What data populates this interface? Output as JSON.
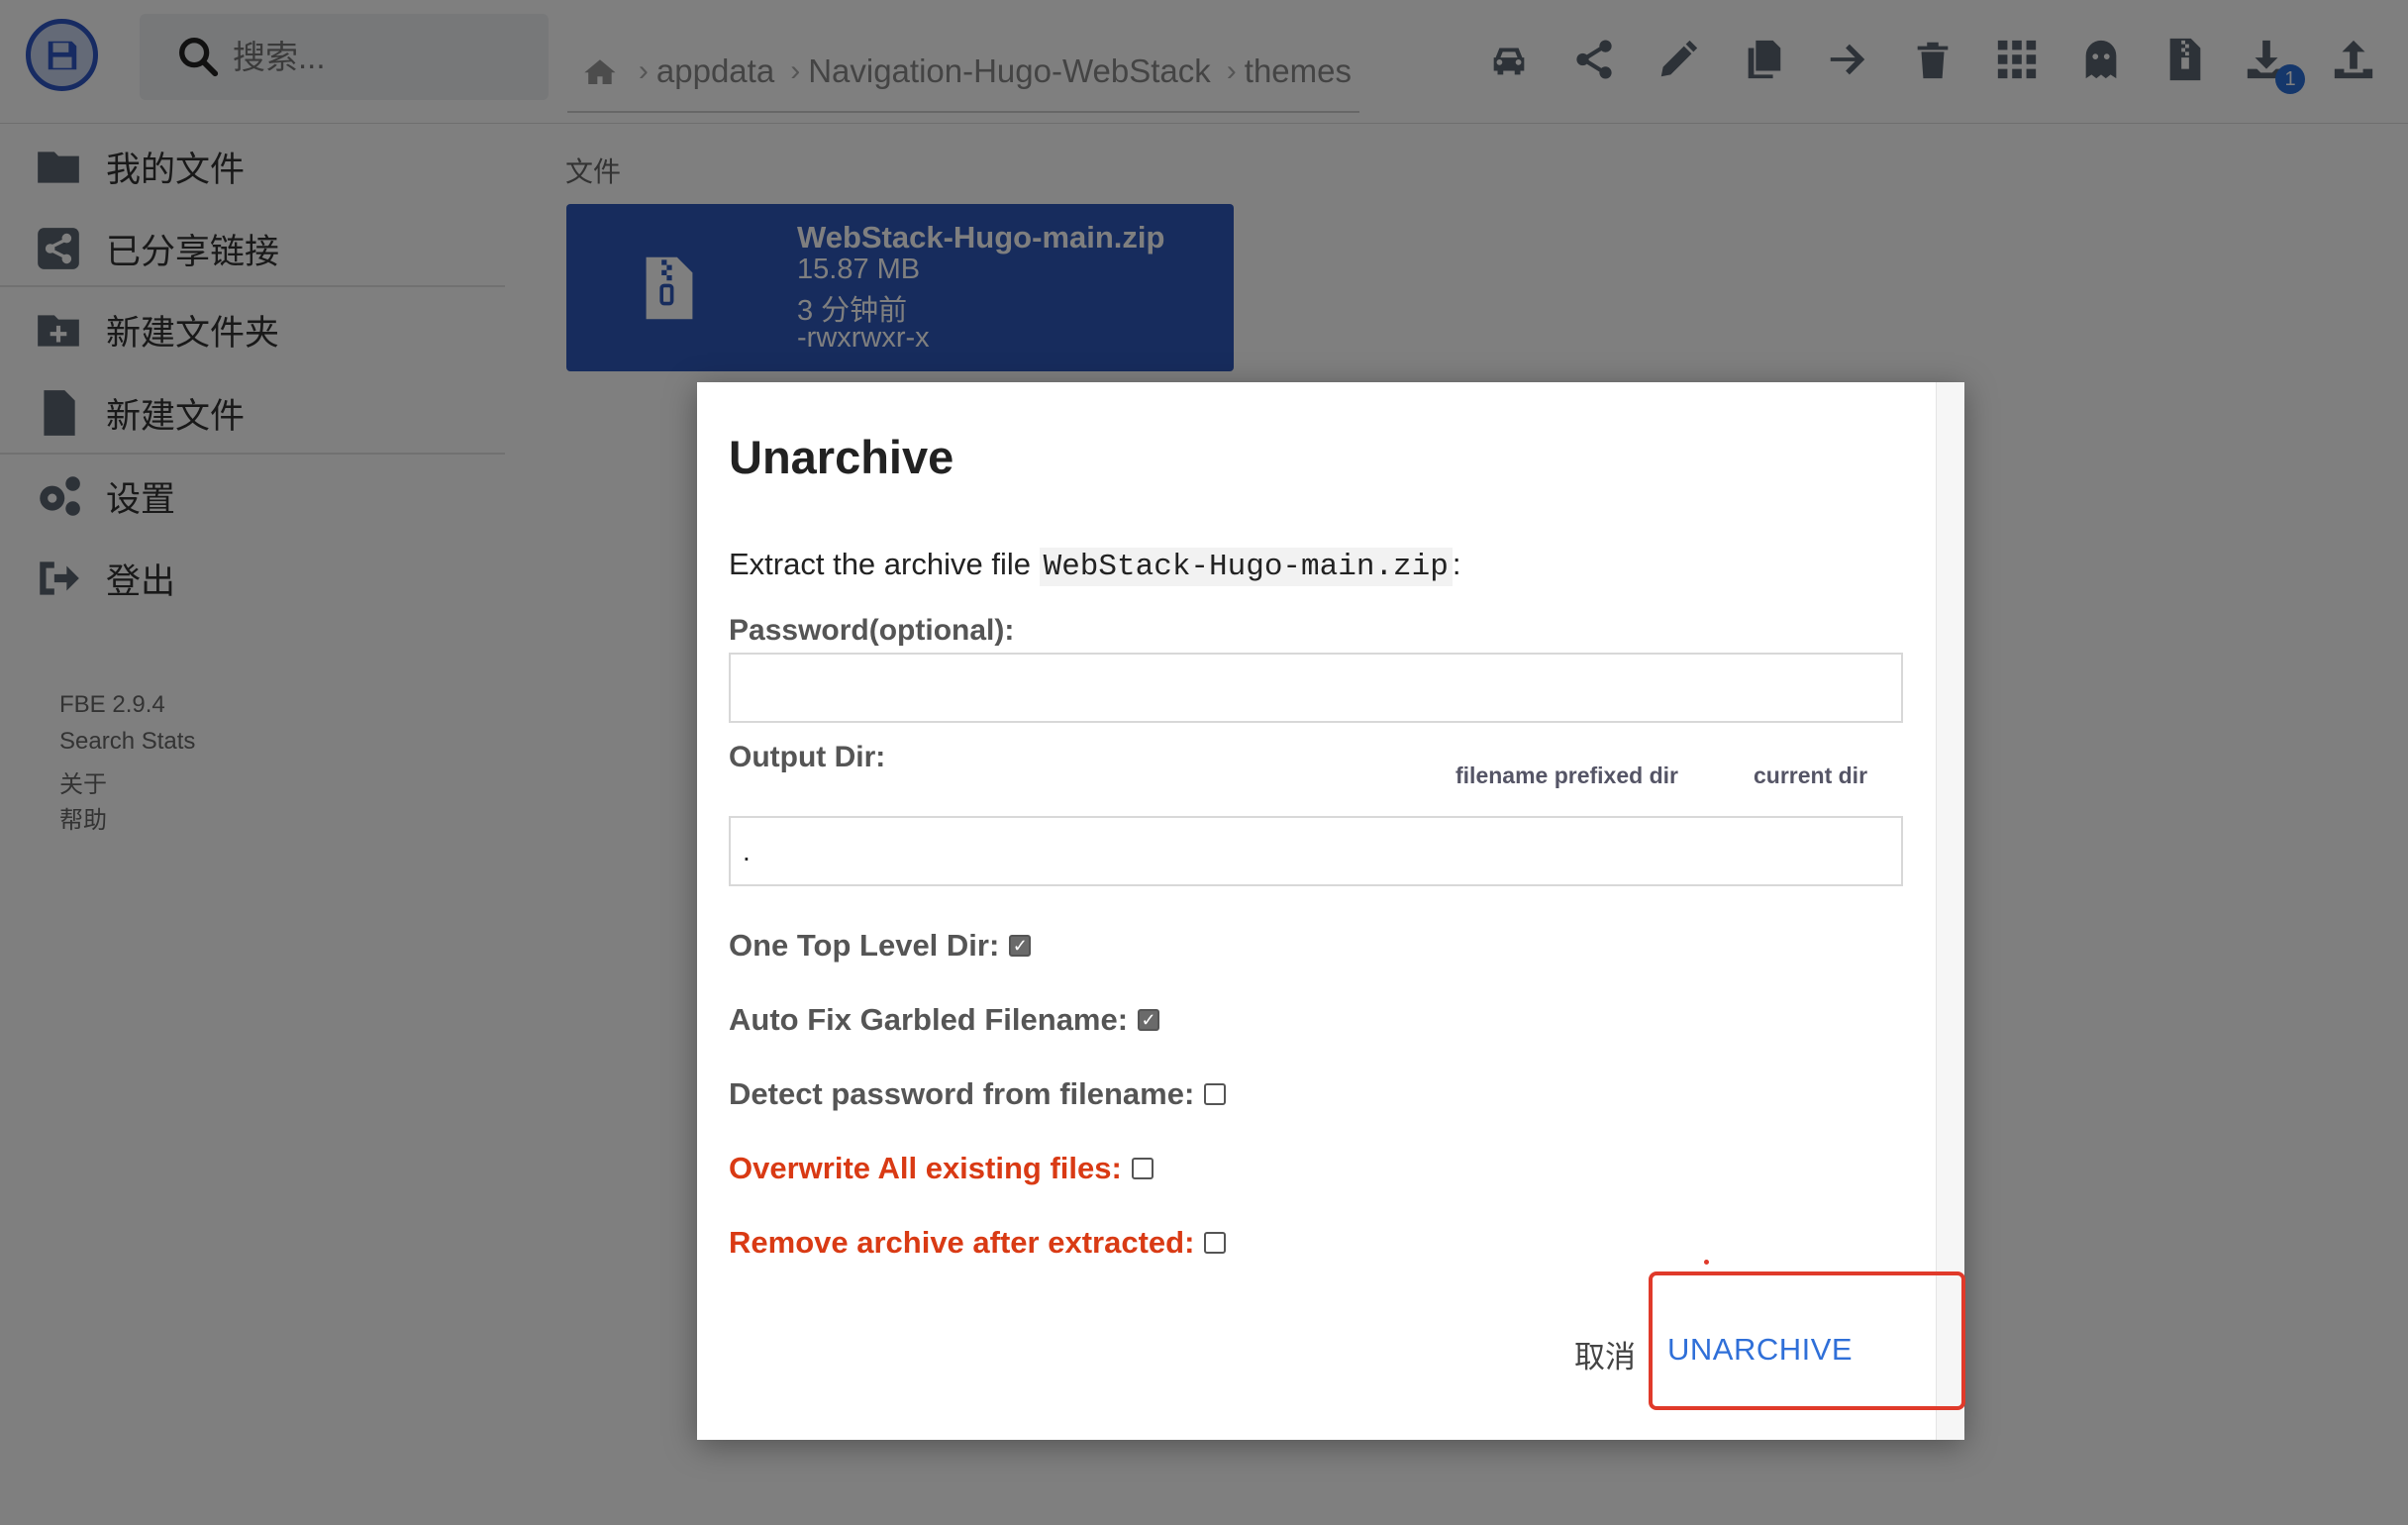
{
  "header": {
    "search_placeholder": "搜索...",
    "breadcrumb": [
      "appdata",
      "Navigation-Hugo-WebStack",
      "themes"
    ],
    "download_badge": "1",
    "tools": [
      "car-icon",
      "share-icon",
      "pencil-icon",
      "copy-icon",
      "arrow-right-icon",
      "trash-icon",
      "grid-icon",
      "ghost-icon",
      "zip-file-icon",
      "download-icon",
      "upload-icon"
    ]
  },
  "sidebar": {
    "items": [
      {
        "label": "我的文件",
        "icon": "folder-icon"
      },
      {
        "label": "已分享链接",
        "icon": "share-square-icon"
      },
      {
        "label": "新建文件夹",
        "icon": "folder-plus-icon"
      },
      {
        "label": "新建文件",
        "icon": "file-icon"
      },
      {
        "label": "设置",
        "icon": "gears-icon"
      },
      {
        "label": "登出",
        "icon": "sign-out-icon"
      }
    ],
    "footer": [
      "FBE 2.9.4",
      "Search Stats",
      "关于",
      "帮助"
    ]
  },
  "main": {
    "section_title": "文件",
    "file": {
      "name": "WebStack-Hugo-main.zip",
      "size": "15.87 MB",
      "modified": "3 分钟前",
      "permissions": "-rwxrwxr-x"
    }
  },
  "dialog": {
    "title": "Unarchive",
    "extract_prefix": "Extract the archive file",
    "extract_filename": "WebStack-Hugo-main.zip",
    "extract_suffix": ":",
    "password_label": "Password(optional):",
    "password_value": "",
    "output_label": "Output Dir:",
    "output_options": [
      "filename prefixed dir",
      "current dir"
    ],
    "output_value": ".",
    "checkboxes": [
      {
        "label": "One Top Level Dir:",
        "checked": true,
        "warning": false
      },
      {
        "label": "Auto Fix Garbled Filename:",
        "checked": true,
        "warning": false
      },
      {
        "label": "Detect password from filename:",
        "checked": false,
        "warning": false
      },
      {
        "label": "Overwrite All existing files:",
        "checked": false,
        "warning": true
      },
      {
        "label": "Remove archive after extracted:",
        "checked": false,
        "warning": true
      }
    ],
    "cancel_label": "取消",
    "confirm_label": "UNARCHIVE"
  },
  "colors": {
    "accent": "#2f58ba",
    "warning": "#d93a14",
    "link": "#2f6fd8",
    "highlight": "#e03a2a"
  }
}
